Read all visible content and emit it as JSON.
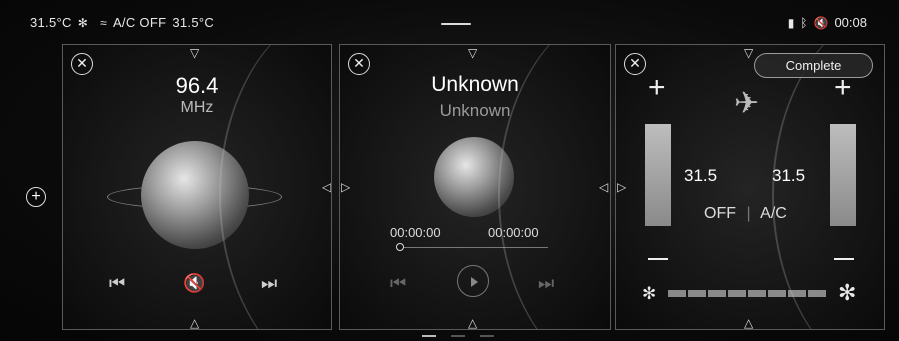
{
  "status": {
    "outside_temp": "31.5°C",
    "ac_text": "A/C OFF",
    "cabin_temp": "31.5°C",
    "clock": "00:08",
    "icons": [
      "fan-icon",
      "seat-heat-icon",
      "battery-icon",
      "bluetooth-icon",
      "mute-icon"
    ]
  },
  "radio": {
    "close": "✕",
    "frequency": "96.4",
    "unit": "MHz",
    "prev": "⏮",
    "mute": "🔇",
    "next": "⏭"
  },
  "media": {
    "title": "Unknown",
    "artist": "Unknown",
    "elapsed": "00:00:00",
    "duration": "00:00:00",
    "progress": 0
  },
  "climate": {
    "left_temp": "31.5",
    "right_temp": "31.5",
    "mode": "OFF",
    "ac_label": "A/C",
    "fan_level": 0,
    "fan_segments": 8,
    "complete_label": "Complete"
  },
  "colors": {
    "accent": "#ffffff",
    "background": "#0b0b0b",
    "border": "#5a5a5a"
  }
}
